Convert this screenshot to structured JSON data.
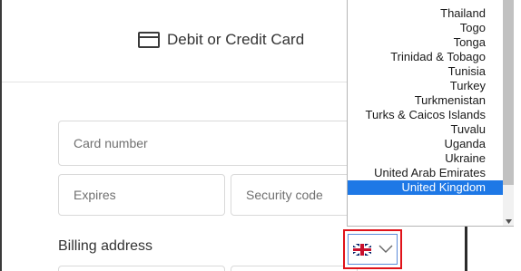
{
  "payment_method": {
    "label": "Debit or Credit Card",
    "icon": "credit-card-icon"
  },
  "form": {
    "card_number_placeholder": "Card number",
    "expires_placeholder": "Expires",
    "security_code_placeholder": "Security code",
    "billing_address_label": "Billing address"
  },
  "country_select": {
    "selected_country": "United Kingdom",
    "flag_icon": "uk-flag-icon",
    "chevron_icon": "chevron-down-icon",
    "highlight_color": "#e0131a"
  },
  "country_dropdown": {
    "options": [
      "Thailand",
      "Togo",
      "Tonga",
      "Trinidad & Tobago",
      "Tunisia",
      "Turkey",
      "Turkmenistan",
      "Turks & Caicos Islands",
      "Tuvalu",
      "Uganda",
      "Ukraine",
      "United Arab Emirates",
      "United Kingdom"
    ],
    "selected_index": 12,
    "selected_color": "#1e78e6"
  }
}
